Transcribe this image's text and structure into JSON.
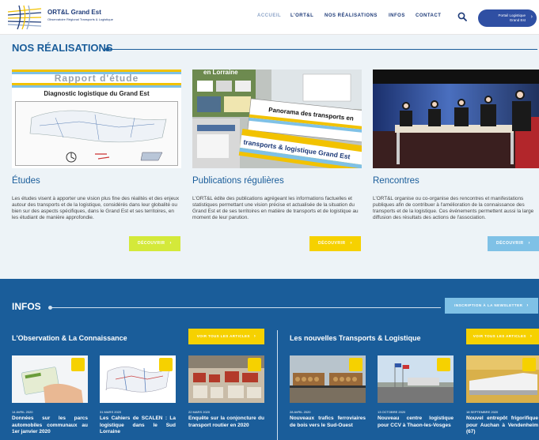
{
  "header": {
    "logo_title": "ORT&L Grand Est",
    "logo_sub": "Observatoire Régional Transports & Logistique",
    "nav": [
      "ACCUEIL",
      "L'ORT&L",
      "NOS RÉALISATIONS",
      "INFOS",
      "CONTACT"
    ],
    "portal_line1": "Portail Logistique",
    "portal_line2": "Grand Est"
  },
  "realisations": {
    "title": "NOS RÉALISATIONS",
    "cards": [
      {
        "title": "Études",
        "text": "Les études visent à apporter une vision plus fine des réalités et des enjeux autour des transports et de la logistique, considérés dans leur globalité ou bien sur des aspects spécifiques, dans le Grand Est et ses territoires, en les étudiant de manière approfondie.",
        "button": "DÉCOUVRIR",
        "button_color": "#d4e93a",
        "image_banner": "Rapport d'étude",
        "image_subtitle": "Diagnostic logistique du Grand Est"
      },
      {
        "title": "Publications régulières",
        "text": "L'ORT&L édite des publications agrégeant les informations factuelles et statistiques permettant une vision précise et actualisée de la situation du Grand Est et de ses territoires en matière de transports et de logistique au moment de leur parution.",
        "button": "DÉCOUVRIR",
        "button_color": "#f6d100",
        "image_banner": "Panorama des transports en",
        "image_subtitle": "transports & logistique Grand Est",
        "image_corner": "en Lorraine"
      },
      {
        "title": "Rencontres",
        "text": "L'ORT&L organise ou co-organise des rencontres et manifestations publiques afin de contribuer à l'amélioration de la connaissance des transports et de la logistique. Ces événements permettent aussi la large diffusion des résultats des actions de l'association.",
        "button": "DÉCOUVRIR",
        "button_color": "#7fc1e6"
      }
    ]
  },
  "infos": {
    "title": "INFOS",
    "newsletter": "INSCRIPTION À LA NEWSLETTER",
    "columns": [
      {
        "title": "L'Observation & La Connaissance",
        "button": "VOIR TOUS LES ARTICLES"
      },
      {
        "title": "Les nouvelles Transports & Logistique",
        "button": "VOIR TOUS LES ARTICLES"
      }
    ],
    "news": [
      {
        "date": "14 AVRIL 2020",
        "title": "Données sur les parcs automobiles communaux au 1er janvier 2020"
      },
      {
        "date": "31 MARS 2020",
        "title": "Les Cahiers de SCALEN : La logistique dans le Sud Lorraine"
      },
      {
        "date": "22 MARS 2020",
        "title": "Enquête sur la conjoncture du transport routier en 2020"
      },
      {
        "date": "28 AVRIL 2020",
        "title": "Nouveaux trafics ferroviaires de bois vers le Sud-Ouest"
      },
      {
        "date": "13 OCTOBRE 2020",
        "title": "Nouveau centre logistique pour CCV à Thaon-les-Vosges"
      },
      {
        "date": "18 SEPTEMBRE 2020",
        "title": "Nouvel entrepôt frigorifique pour Auchan à Vendenheim (67)"
      }
    ]
  }
}
